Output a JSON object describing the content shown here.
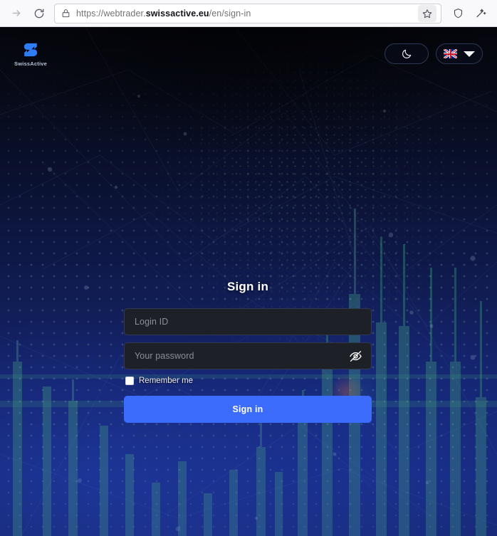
{
  "browser": {
    "forward_icon": "forward-arrow-icon",
    "reload_icon": "reload-icon",
    "lock_icon": "lock-icon",
    "url_prefix": "https://webtrader.",
    "url_host": "swissactive.eu",
    "url_path": "/en/sign-in",
    "url_full": "https://webtrader.swissactive.eu/en/sign-in",
    "bookmark_icon": "star-icon",
    "shield_icon": "shield-icon",
    "extension_icon": "magic-wand-icon"
  },
  "header": {
    "brand_name": "SwissActive",
    "logo_icon": "swissactive-s-logo",
    "theme_toggle_icon": "moon-icon",
    "language_flag": "uk-flag-icon",
    "language_caret_icon": "chevron-down-icon"
  },
  "signin": {
    "title": "Sign in",
    "login_placeholder": "Login ID",
    "login_value": "",
    "password_placeholder": "Your password",
    "password_value": "",
    "password_toggle_icon": "eye-off-icon",
    "remember_label": "Remember me",
    "remember_checked": false,
    "submit_label": "Sign in"
  },
  "colors": {
    "accent": "#3b6cfb",
    "field_bg": "#1d2027",
    "field_border": "#34384a",
    "placeholder": "#8b8f99",
    "page_bg_top": "#05060d",
    "page_bg_bottom": "#16276f",
    "logo_blue": "#2f7df6",
    "candle_teal": "#3e8f7f"
  }
}
